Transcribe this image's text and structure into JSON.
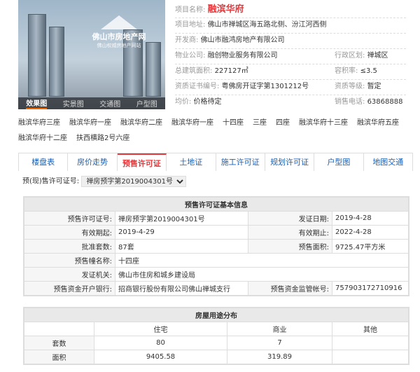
{
  "photo": {
    "watermark_title": "佛山市房地产网",
    "watermark_sub": "佛山权威房地产网站",
    "tabs": [
      "效果图",
      "实景图",
      "交通图",
      "户型图"
    ]
  },
  "info": {
    "name_label": "项目名称:",
    "name": "融滨华府",
    "address_label": "项目地址:",
    "address": "佛山市禅城区海五路北侧、汾江河西侧",
    "developer_label": "开发商:",
    "developer": "佛山市融鸿房地产有限公司",
    "property_label": "物业公司:",
    "property": "融创物业服务有限公司",
    "district_label": "行政区划:",
    "district": "禅城区",
    "area_label": "总建筑面积:",
    "area": "227127㎡",
    "ratio_label": "容积率:",
    "ratio": "≤3.5",
    "cert_label": "资质证书编号:",
    "cert": "粤佛房开证字第1301212号",
    "grade_label": "资质等级:",
    "grade": "暂定",
    "price_label": "均价:",
    "price": "价格待定",
    "phone_label": "销售电话:",
    "phone": "63868888"
  },
  "buildings": [
    "融滨华府三座",
    "融滨华府一座",
    "融滨华府二座",
    "融滨华府一座",
    "十四座",
    "三座",
    "四座",
    "融滨华府十三座",
    "融滨华府五座",
    "融滨华府十二座",
    "扶西横路2号六座"
  ],
  "tabs": [
    "楼盘表",
    "房价走势",
    "预售许可证",
    "土地证",
    "施工许可证",
    "规划许可证",
    "户型图",
    "地图交通"
  ],
  "selector": {
    "label": "预(现)售许可证号:",
    "value": "禅房预字第2019004301号"
  },
  "license": {
    "title": "预售许可证基本信息",
    "no_label": "预售许可证号:",
    "no": "禅房预字第2019004301号",
    "issue_label": "发证日期:",
    "issue": "2019-4-28",
    "start_label": "有效期起:",
    "start": "2019-4-29",
    "end_label": "有效期止:",
    "end": "2022-4-28",
    "sets_label": "批准套数:",
    "sets": "87套",
    "pre_area_label": "预售面积:",
    "pre_area": "9725.47平方米",
    "bldg_label": "预售幢名称:",
    "bldg": "十四座",
    "org_label": "发证机关:",
    "org": "佛山市住房和城乡建设局",
    "bank_label": "预售资金开户银行:",
    "bank": "招商银行股份有限公司佛山禅城支行",
    "acct_label": "预售资金监管帐号:",
    "acct": "757903172710916"
  },
  "usage": {
    "title": "房屋用途分布",
    "cols": [
      "住宅",
      "商业",
      "其他"
    ],
    "rows": [
      {
        "label": "套数",
        "values": [
          "80",
          "7",
          ""
        ]
      },
      {
        "label": "面积",
        "values": [
          "9405.58",
          "319.89",
          ""
        ]
      }
    ]
  }
}
